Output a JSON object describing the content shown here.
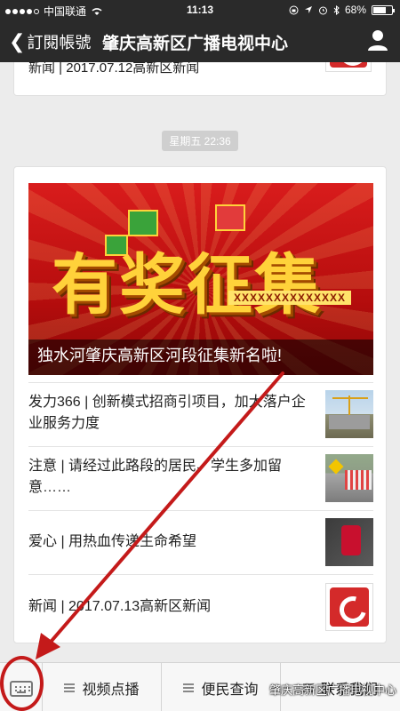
{
  "status_bar": {
    "carrier": "中国联通",
    "time": "11:13",
    "battery": "68%",
    "battery_level": 0.68,
    "signal_dots_filled": 4
  },
  "nav": {
    "back_label": "訂閱帳號",
    "title": "肇庆高新区广播电视中心"
  },
  "feed": {
    "previous_item_text": "新闻 | 2017.07.12高新区新闻",
    "timestamp": "星期五 22:36",
    "main_card": {
      "banner_big_text": "有奖征集",
      "banner_small_text": "XXXXXXXXXXXXXX",
      "banner_caption": "独水河肇庆高新区河段征集新名啦!",
      "items": [
        {
          "text": "发力366 | 创新模式招商引项目，加大落户企业服务力度",
          "thumb_icon": "construction-thumbnail"
        },
        {
          "text": "注意 | 请经过此路段的居民、学生多加留意……",
          "thumb_icon": "road-sign-thumbnail"
        },
        {
          "text": "爱心 | 用热血传递生命希望",
          "thumb_icon": "blood-bag-thumbnail"
        },
        {
          "text": "新闻 | 2017.07.13高新区新闻",
          "thumb_icon": "station-logo-thumbnail"
        }
      ]
    }
  },
  "bottom_menu": {
    "keyboard_icon": "keyboard-icon",
    "items": [
      {
        "label": "视频点播"
      },
      {
        "label": "便民查询"
      },
      {
        "label": "联系我们"
      }
    ],
    "watermark": "肇庆高新区广播电视中心"
  },
  "colors": {
    "nav_background": "#2a2a2a",
    "annotation_red": "#c41a1a",
    "banner_red": "#d91c1c"
  }
}
